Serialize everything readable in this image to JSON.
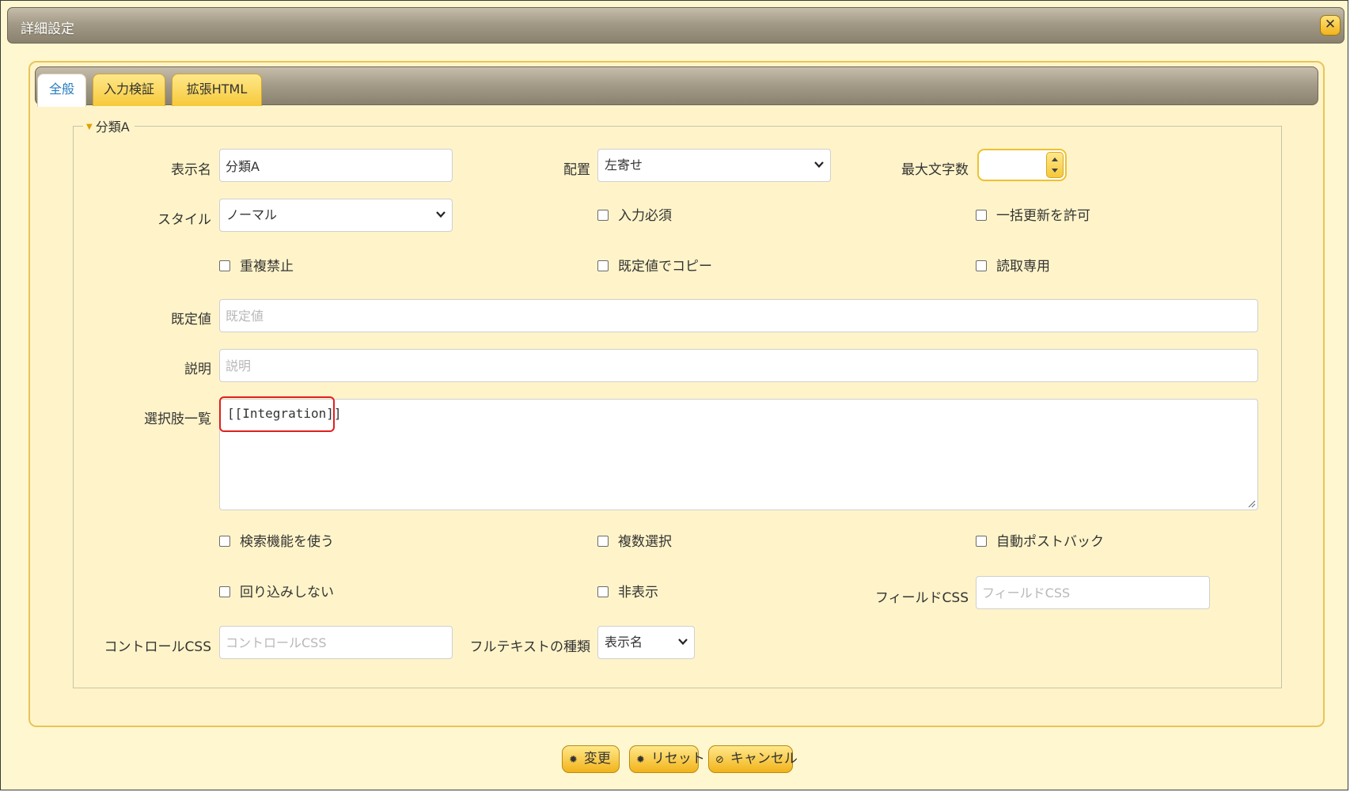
{
  "dialog": {
    "title": "詳細設定",
    "close_icon": "close-icon"
  },
  "tabs": [
    {
      "label": "全般",
      "active": true
    },
    {
      "label": "入力検証",
      "active": false
    },
    {
      "label": "拡張HTML",
      "active": false
    }
  ],
  "section": {
    "legend": "分類A"
  },
  "fields": {
    "display_name": {
      "label": "表示名",
      "value": "分類A"
    },
    "alignment": {
      "label": "配置",
      "value": "左寄せ"
    },
    "max_length": {
      "label": "最大文字数",
      "value": ""
    },
    "style": {
      "label": "スタイル",
      "value": "ノーマル"
    },
    "default_value": {
      "label": "既定値",
      "placeholder": "既定値"
    },
    "description": {
      "label": "説明",
      "placeholder": "説明"
    },
    "choices": {
      "label": "選択肢一覧",
      "value": "[[Integration]]"
    },
    "field_css": {
      "label": "フィールドCSS",
      "placeholder": "フィールドCSS"
    },
    "control_css": {
      "label": "コントロールCSS",
      "placeholder": "コントロールCSS"
    },
    "fulltext_type": {
      "label": "フルテキストの種類",
      "value": "表示名"
    }
  },
  "checkboxes": {
    "required": {
      "label": "入力必須",
      "checked": false
    },
    "bulk_update": {
      "label": "一括更新を許可",
      "checked": false
    },
    "no_duplicates": {
      "label": "重複禁止",
      "checked": false
    },
    "copy_by_default": {
      "label": "既定値でコピー",
      "checked": false
    },
    "read_only": {
      "label": "読取専用",
      "checked": false
    },
    "use_search": {
      "label": "検索機能を使う",
      "checked": false
    },
    "multiple_select": {
      "label": "複数選択",
      "checked": false
    },
    "auto_postback": {
      "label": "自動ポストバック",
      "checked": false
    },
    "no_wrap": {
      "label": "回り込みしない",
      "checked": false
    },
    "hidden": {
      "label": "非表示",
      "checked": false
    }
  },
  "buttons": {
    "change": {
      "label": "変更",
      "icon": "gear-icon"
    },
    "reset": {
      "label": "リセット",
      "icon": "gear-icon"
    },
    "cancel": {
      "label": "キャンセル",
      "icon": "cancel-icon"
    }
  },
  "colors": {
    "background": "#fff7cf",
    "accent": "#f6c93a",
    "titlebar": "#a29a86",
    "highlight": "#e0201e",
    "active_tab_text": "#2a7ec0"
  }
}
